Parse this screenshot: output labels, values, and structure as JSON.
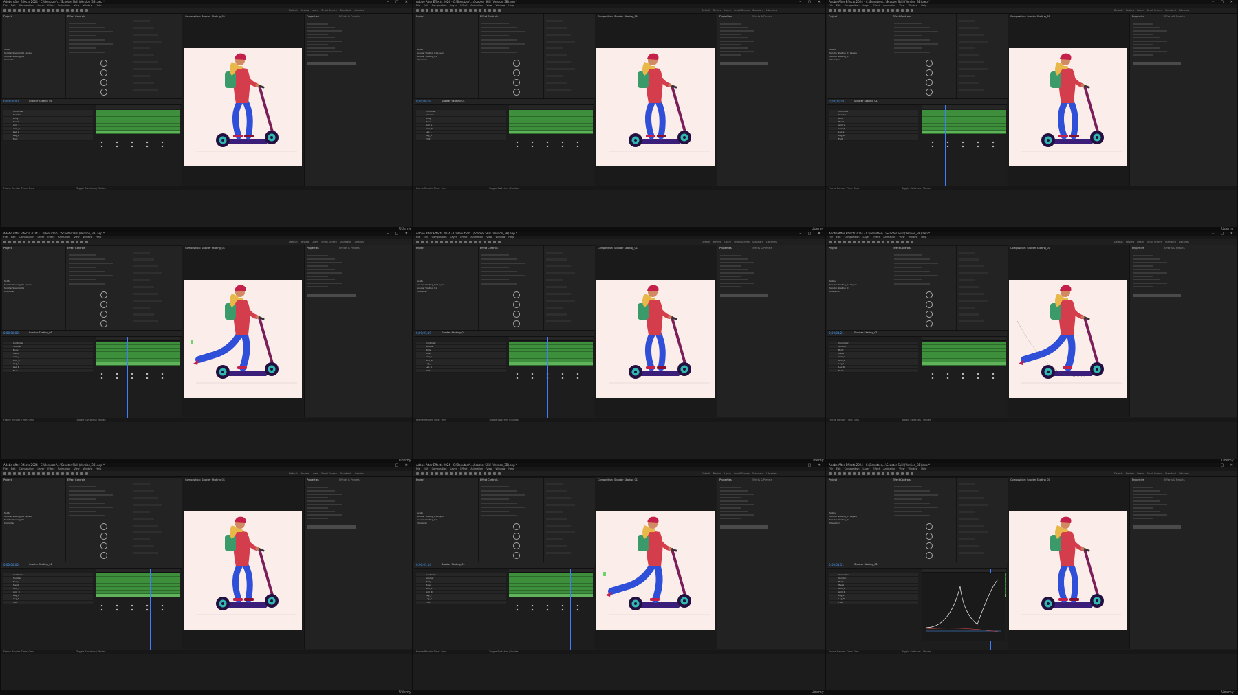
{
  "app": {
    "title": "Adobe After Effects 2024 - C:\\Benutzer\\...\\Scooter Skill (Version_3B).aep *",
    "menu": [
      "File",
      "Edit",
      "Composition",
      "Layer",
      "Effect",
      "Animation",
      "View",
      "Window",
      "Help"
    ],
    "workspaces": [
      "Default",
      "Review",
      "Learn",
      "Small Screen",
      "Standard",
      "Libraries"
    ],
    "window_controls": "– ▢ ✕"
  },
  "panels": {
    "project_tab": "Project",
    "effect_controls_tab": "Effect Controls",
    "composition_tab": "Composition: Scooter Skating_01",
    "comp_name": "Scooter Skating_01",
    "properties_tab": "Properties",
    "effects_tab": "Effects & Presets",
    "timeline_tab": "Scooter Skating_01",
    "render_time": "Frame Render Time: 0ms",
    "toggle": "Toggle Switches / Modes"
  },
  "project_items": [
    "Solids",
    "Scooter Skating_01 Layers",
    "Scooter Skating_01",
    "Character"
  ],
  "layers": [
    "Controller",
    "Scooter",
    "Body",
    "Head",
    "Arm_L",
    "Arm_R",
    "Leg_L",
    "Leg_R",
    "Foot"
  ],
  "timecodes": [
    "0;00;00;00",
    "0;00;00;19",
    "0;00;00;19",
    "0;00;00;00",
    "0;00;01;19",
    "0;00;01;21",
    "0;00;00;00",
    "0;00;01;14",
    "0;00;01;11"
  ],
  "poses": [
    "stand",
    "stand",
    "stand",
    "kick",
    "stand",
    "kick-close",
    "stand",
    "kick",
    "stand-graph"
  ],
  "watermark": "Udemy",
  "colors": {
    "ui_bg": "#1c1c1c",
    "canvas": "#fbeeea",
    "layer_bar": "#3e8f3c",
    "playhead": "#3d7dff",
    "helmet": "#c4204a",
    "hair": "#e8b94a",
    "backpack": "#3a9a6a",
    "jacket": "#d43d4c",
    "pants": "#2f4fd8",
    "scooter_frame": "#3a1e7a",
    "scooter_stem": "#7a1f5a",
    "wheel_hub": "#2fb7b0"
  }
}
